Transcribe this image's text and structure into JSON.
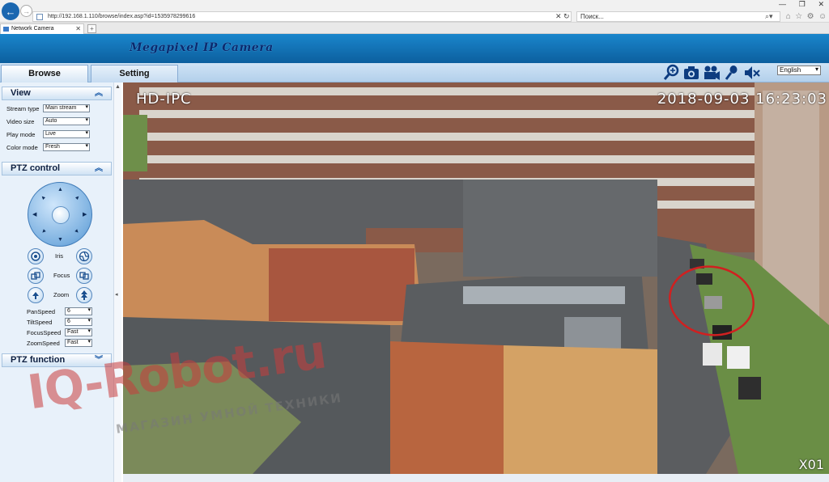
{
  "browser": {
    "url": "http://192.168.1.110/browse/index.asp?id=1535978299616",
    "search_placeholder": "Поиск...",
    "tab_title": "Network Camera",
    "window_controls": [
      "—",
      "❐",
      "✕"
    ]
  },
  "banner": {
    "title": "Megapixel IP Camera"
  },
  "nav": {
    "tabs": [
      {
        "label": "Browse",
        "active": true
      },
      {
        "label": "Setting",
        "active": false
      }
    ],
    "language": "English",
    "toolbar": [
      "zoom-in-icon",
      "snapshot-camera-icon",
      "record-video-icon",
      "microphone-icon",
      "speaker-mute-icon"
    ]
  },
  "sidebar": {
    "view": {
      "header": "View",
      "fields": [
        {
          "label": "Stream type",
          "value": "Main stream"
        },
        {
          "label": "Video size",
          "value": "Auto"
        },
        {
          "label": "Play mode",
          "value": "Live"
        },
        {
          "label": "Color mode",
          "value": "Fresh"
        }
      ]
    },
    "ptz_control": {
      "header": "PTZ control",
      "lens": [
        {
          "label": "Iris"
        },
        {
          "label": "Focus"
        },
        {
          "label": "Zoom"
        }
      ],
      "speeds": [
        {
          "label": "PanSpeed",
          "value": "6"
        },
        {
          "label": "TiltSpeed",
          "value": "6"
        },
        {
          "label": "FocusSpeed",
          "value": "Fast"
        },
        {
          "label": "ZoomSpeed",
          "value": "Fast"
        }
      ]
    },
    "ptz_function": {
      "header": "PTZ function"
    }
  },
  "video": {
    "osd_name": "HD-IPC",
    "osd_time": "2018-09-03  16:23:03",
    "osd_channel": "X01",
    "highlight_color": "#d02020"
  },
  "watermark": {
    "brand": "IQ-Robot.ru",
    "tagline": "МАГАЗИН УМНОЙ ТЕХНИКИ"
  },
  "colors": {
    "banner": "#0c5f9e",
    "sidebar": "#e8f1fa",
    "title": "#0a2a6e"
  }
}
